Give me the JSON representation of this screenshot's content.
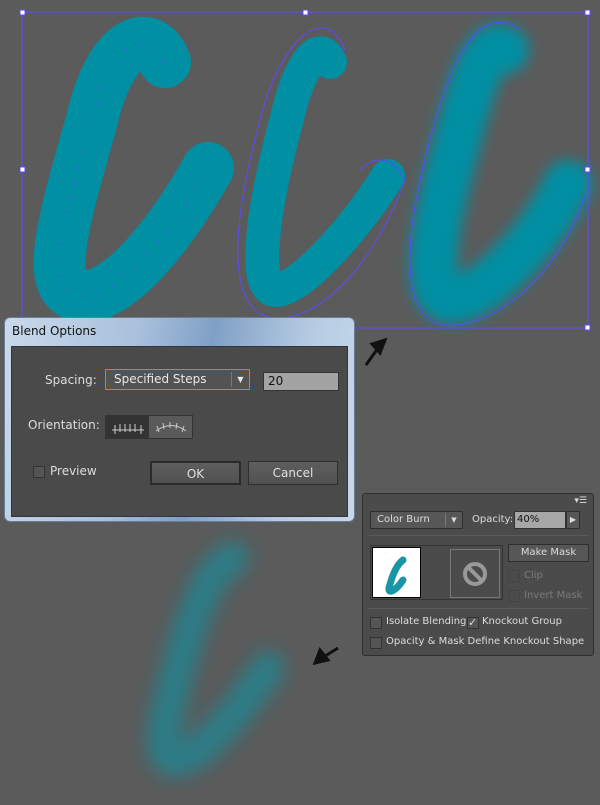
{
  "colors": {
    "canvas": "#5b5b5b",
    "artwork": "#008fa3",
    "selection": "#5b4bff",
    "dialog_focus": "#e07a20"
  },
  "blend_options": {
    "title": "Blend Options",
    "spacing_label": "Spacing:",
    "spacing_value": "Specified Steps",
    "steps_value": "20",
    "orientation_label": "Orientation:",
    "orientation_options": [
      "align-to-page-icon",
      "align-to-path-icon"
    ],
    "preview_label": "Preview",
    "preview_checked": false,
    "ok_label": "OK",
    "cancel_label": "Cancel"
  },
  "transparency": {
    "blend_mode": "Color Burn",
    "opacity_label": "Opacity:",
    "opacity_value": "40%",
    "make_mask_label": "Make Mask",
    "clip_label": "Clip",
    "invert_mask_label": "Invert Mask",
    "isolate_label": "Isolate Blending",
    "isolate_checked": false,
    "knockout_label": "Knockout Group",
    "knockout_checked": true,
    "define_label": "Opacity & Mask Define Knockout Shape",
    "define_checked": false
  }
}
